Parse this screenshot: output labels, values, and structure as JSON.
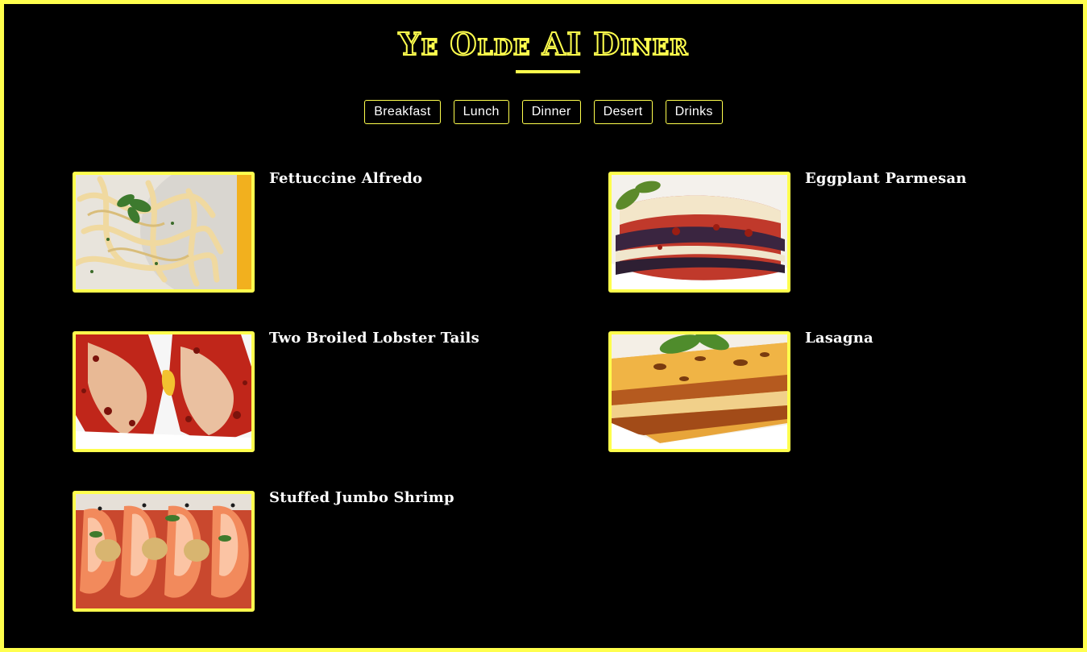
{
  "header": {
    "title": "Ye Olde AI Diner"
  },
  "nav": {
    "items": [
      {
        "label": "Breakfast"
      },
      {
        "label": "Lunch"
      },
      {
        "label": "Dinner"
      },
      {
        "label": "Desert"
      },
      {
        "label": "Drinks"
      }
    ]
  },
  "menu": {
    "items": [
      {
        "name": "Fettuccine Alfredo",
        "image": "fettuccine-alfredo-photo"
      },
      {
        "name": "Eggplant Parmesan",
        "image": "eggplant-parmesan-photo"
      },
      {
        "name": "Two Broiled Lobster Tails",
        "image": "lobster-tails-photo"
      },
      {
        "name": "Lasagna",
        "image": "lasagna-photo"
      },
      {
        "name": "Stuffed Jumbo Shrimp",
        "image": "stuffed-shrimp-photo"
      }
    ]
  },
  "theme": {
    "accent": "#ffff4d",
    "background": "#000000",
    "text": "#ffffff"
  }
}
